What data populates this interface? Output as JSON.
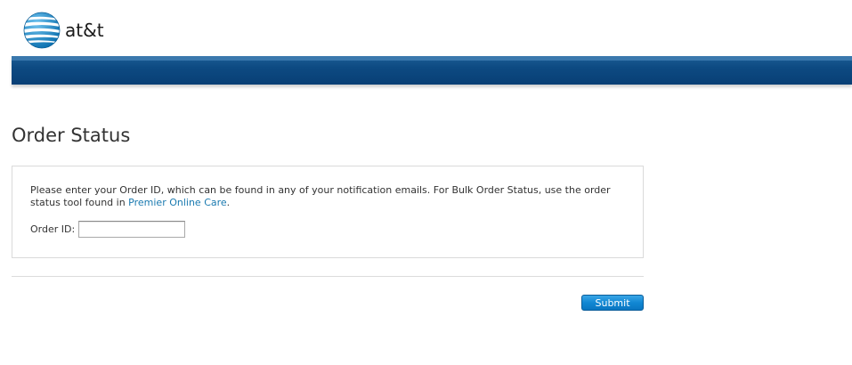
{
  "header": {
    "logo_text": "at&t"
  },
  "main": {
    "title": "Order Status",
    "instructions_text": "Please enter your Order ID, which can be found in any of your notification emails. For Bulk Order Status, use the order status tool found in ",
    "instructions_link": "Premier Online Care",
    "instructions_end": ".",
    "order_id_label": "Order ID:",
    "order_id_value": "",
    "submit_label": "Submit"
  },
  "colors": {
    "nav_bar": "#0d4a82",
    "link": "#1a7ab0",
    "submit_button": "#1287d3"
  },
  "icons": {
    "logo": "att-globe-icon"
  }
}
